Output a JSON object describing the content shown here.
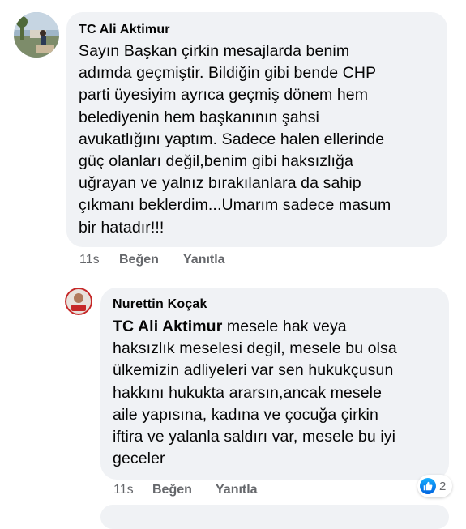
{
  "comment1": {
    "author": "TC Ali Aktimur",
    "lines": [
      "Sayın Başkan çirkin mesajlarda benim",
      "adımda geçmiştir. Bildiğin gibi bende CHP",
      "parti üyesiyim ayrıca geçmiş dönem hem",
      "belediyenin hem başkanının şahsi",
      "avukatlığını yaptım. Sadece halen ellerinde",
      "güç olanları değil,benim gibi haksızlığa",
      "uğrayan ve yalnız bırakılanlara da sahip",
      "çıkmanı beklerdim...Umarım sadece masum",
      "bir hatadır!!!"
    ],
    "time": "11s",
    "like_label": "Beğen",
    "reply_label": "Yanıtla"
  },
  "comment2": {
    "author": "Nurettin Koçak",
    "mention": "TC Ali Aktimur",
    "first_line_rest": " mesele hak veya",
    "lines": [
      "haksızlık meselesi degil, mesele bu olsa",
      "ülkemizin adliyeleri var sen hukukçusun",
      "hakkını hukukta ararsın,ancak mesele",
      "aile yapısına, kadına ve çocuğa  çirkin",
      "iftira ve yalanla saldırı var, mesele bu iyi",
      "geceler"
    ],
    "time": "11s",
    "like_label": "Beğen",
    "reply_label": "Yanıtla",
    "reaction_count": "2",
    "reaction_icon": "like-icon",
    "reaction_color": "#1877f2"
  }
}
